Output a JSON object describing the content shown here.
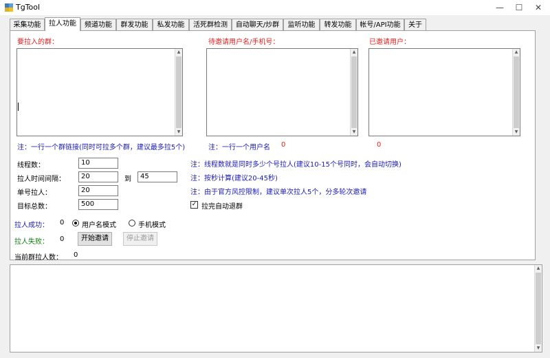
{
  "window": {
    "title": "TgTool"
  },
  "tabs": [
    {
      "label": "采集功能"
    },
    {
      "label": "拉人功能"
    },
    {
      "label": "频道功能"
    },
    {
      "label": "群发功能"
    },
    {
      "label": "私发功能"
    },
    {
      "label": "活死群检测"
    },
    {
      "label": "自动聊天/炒群"
    },
    {
      "label": "监听功能"
    },
    {
      "label": "转发功能"
    },
    {
      "label": "帐号/API功能"
    },
    {
      "label": "关于"
    }
  ],
  "sections": {
    "groups_label": "要拉入的群：",
    "pending_label": "待邀请用户名/手机号：",
    "invited_label": "已邀请用户："
  },
  "notes": {
    "group_note": "注：一行一个群链接(同时可拉多个群，建议最多拉5个)",
    "user_note": "注：一行一个用户名",
    "pending_count": "0",
    "invited_count": "0",
    "threads_note": "注：线程数就是同时多少个号拉人(建议10-15个号同时，会自动切换)",
    "interval_note": "注：按秒计算(建议20-45秒)",
    "limit_note": "注：由于官方风控限制，建议单次拉人5个，分多轮次邀请"
  },
  "settings": {
    "threads_label": "线程数：",
    "threads_value": "10",
    "interval_label": "拉人时间间隔：",
    "interval_min": "20",
    "to_label": "到",
    "interval_max": "45",
    "per_account_label": "单号拉人：",
    "per_account_value": "20",
    "target_label": "目标总数：",
    "target_value": "500",
    "auto_leave_label": "拉完自动退群"
  },
  "status": {
    "success_label": "拉人成功：",
    "success_count": "0",
    "fail_label": "拉人失败：",
    "fail_count": "0",
    "current_label": "当前群拉人数：",
    "current_count": "0"
  },
  "mode": {
    "username_mode": "用户名模式",
    "phone_mode": "手机模式"
  },
  "buttons": {
    "start": "开始邀请",
    "stop": "停止邀请"
  }
}
